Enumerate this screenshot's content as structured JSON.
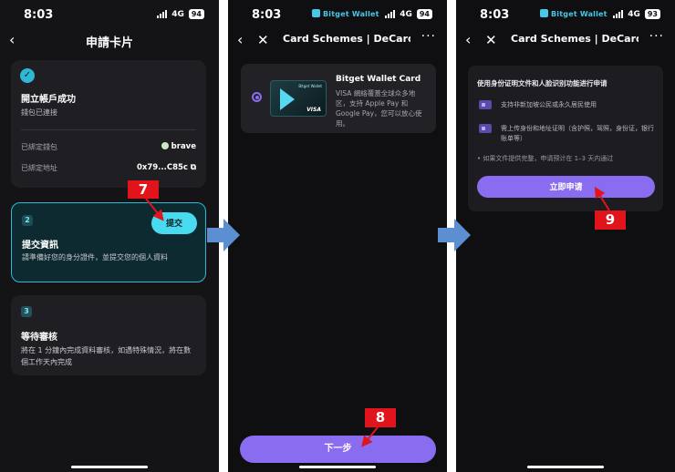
{
  "screens": {
    "s1": {
      "status": {
        "time": "8:03",
        "network": "4G",
        "battery": "94"
      },
      "title": "申請卡片",
      "step1": {
        "title": "開立帳戶成功",
        "subtitle": "錢包已連接",
        "rows": [
          {
            "label": "已綁定錢包",
            "value": "brave"
          },
          {
            "label": "已綁定地址",
            "value": "0x79...C85c ⧉"
          }
        ]
      },
      "step2": {
        "number": "2",
        "title": "提交資訊",
        "text": "請準備好您的身分證件，並提交您的個人資料",
        "button": "提交"
      },
      "step3": {
        "number": "3",
        "title": "等待審核",
        "text": "將在 1 分鐘內完成資料審核，如遇特殊情況，將在數個工作天內完成"
      }
    },
    "s2": {
      "status": {
        "time": "8:03",
        "brand": "Bitget Wallet",
        "network": "4G",
        "battery": "94"
      },
      "title": "Card Schemes | DeCard",
      "card": {
        "title": "Bitget Wallet Card",
        "description": "VISA 網絡覆蓋全球众多地区，支持 Apple Pay 和 Google Pay，您可以放心使用。",
        "brand_mark": "VISA",
        "mini_text": "Bitget Wallet"
      },
      "button": "下一步"
    },
    "s3": {
      "status": {
        "time": "8:03",
        "brand": "Bitget Wallet",
        "network": "4G",
        "battery": "93"
      },
      "title": "Card Schemes | DeCard",
      "heading": "使用身份证明文件和人脸识别功能进行申请",
      "items": [
        "支持非新加坡公民或永久居民使用",
        "需上传身份和地址证明（含护照，驾照，身份证，银行账单等）"
      ],
      "note": "• 如果文件提供完整，申请预计在 1–3 天内通过",
      "button": "立即申请"
    }
  },
  "markers": [
    "7",
    "8",
    "9"
  ],
  "colors": {
    "accent_cyan": "#48dbef",
    "accent_purple": "#8a6cf0",
    "marker_red": "#e1141b",
    "flow_arrow": "#5b8fd1"
  }
}
